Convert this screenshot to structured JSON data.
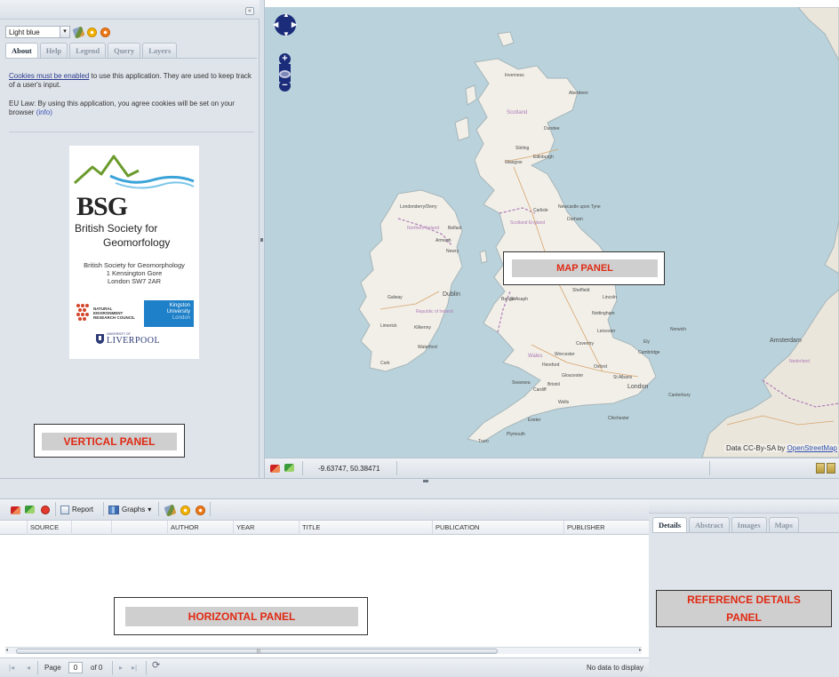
{
  "left_panel": {
    "style_select": "Light blue",
    "tabs": [
      {
        "label": "About",
        "active": true
      },
      {
        "label": "Help",
        "active": false
      },
      {
        "label": "Legend",
        "active": false
      },
      {
        "label": "Query",
        "active": false
      },
      {
        "label": "Layers",
        "active": false
      }
    ],
    "cookies_link": "Cookies must be enabled",
    "cookies_text": " to use this application. They are used to keep track of a user's input.",
    "eu_text": "EU Law: By using this application, you agree cookies will be set on your browser ",
    "info_link": "(info)",
    "logo": {
      "bsg": "BSG",
      "name_line1": "British Society for",
      "name_line2": "Geomorfology",
      "address": [
        "British Society for Geomorphology",
        "1 Kensington Gore",
        "London SW7 2AR"
      ],
      "nerc": [
        "NATURAL",
        "ENVIRONMENT",
        "RESEARCH COUNCIL"
      ],
      "kingston": [
        "Kingston",
        "University",
        "London"
      ],
      "liverpool_small": "UNIVERSITY OF",
      "liverpool": "LIVERPOOL"
    },
    "annotation": "VERTICAL PANEL"
  },
  "map": {
    "annotation": "MAP PANEL",
    "attribution_prefix": "Data CC-By-SA by ",
    "attribution_link": "OpenStreetMap",
    "places": [
      {
        "name": "Inverness"
      },
      {
        "name": "Aberdeen"
      },
      {
        "name": "Scotland"
      },
      {
        "name": "Dundee"
      },
      {
        "name": "Stirling"
      },
      {
        "name": "Glasgow"
      },
      {
        "name": "Edinburgh"
      },
      {
        "name": "Londonderry/Derry"
      },
      {
        "name": "Northern Ireland"
      },
      {
        "name": "Belfast"
      },
      {
        "name": "Armagh"
      },
      {
        "name": "Newry"
      },
      {
        "name": "Carlisle"
      },
      {
        "name": "Newcastle upon Tyne"
      },
      {
        "name": "Durham"
      },
      {
        "name": "Scotland England"
      },
      {
        "name": "Galway"
      },
      {
        "name": "Dublin"
      },
      {
        "name": "Republic of Ireland"
      },
      {
        "name": "Limerick"
      },
      {
        "name": "Kilkenny"
      },
      {
        "name": "Waterford"
      },
      {
        "name": "Cork"
      },
      {
        "name": "Bangor"
      },
      {
        "name": "St Asaph"
      },
      {
        "name": "Sheffield"
      },
      {
        "name": "Lincoln"
      },
      {
        "name": "Nottingham"
      },
      {
        "name": "Leicester"
      },
      {
        "name": "Coventry"
      },
      {
        "name": "Ely"
      },
      {
        "name": "Norwich"
      },
      {
        "name": "Cambridge"
      },
      {
        "name": "Wales"
      },
      {
        "name": "Worcester"
      },
      {
        "name": "Hereford"
      },
      {
        "name": "Oxford"
      },
      {
        "name": "St Albans"
      },
      {
        "name": "Gloucester"
      },
      {
        "name": "London"
      },
      {
        "name": "Swansea"
      },
      {
        "name": "Cardiff"
      },
      {
        "name": "Bristol"
      },
      {
        "name": "Wells"
      },
      {
        "name": "Canterbury"
      },
      {
        "name": "Chichester"
      },
      {
        "name": "Exeter"
      },
      {
        "name": "Plymouth"
      },
      {
        "name": "Truro"
      },
      {
        "name": "Amsterdam"
      },
      {
        "name": "Nederland"
      }
    ]
  },
  "map_status": {
    "coords": "-9.63747, 50.38471"
  },
  "bottom_panel": {
    "toolbar": {
      "report": "Report",
      "graphs": "Graphs"
    },
    "columns": [
      "SOURCE",
      "AUTHOR",
      "YEAR",
      "TITLE",
      "PUBLICATION",
      "PUBLISHER"
    ],
    "pager": {
      "page_label": "Page",
      "page_value": "0",
      "of_label": "of 0",
      "status": "No data to display"
    },
    "annotation": "HORIZONTAL PANEL"
  },
  "details_panel": {
    "tabs": [
      {
        "label": "Details",
        "active": true
      },
      {
        "label": "Abstract",
        "active": false
      },
      {
        "label": "Images",
        "active": false
      },
      {
        "label": "Maps",
        "active": false
      }
    ],
    "annotation_line1": "REFERENCE DETAILS",
    "annotation_line2": "PANEL"
  },
  "colors": {
    "sea": "#b9d2db",
    "land": "#f1efe8",
    "panel": "#dfe4ea",
    "annotation_text": "#e02a14",
    "nav_control": "#1b2c7a"
  },
  "icons": [
    "collapse-left-icon",
    "paint-icon",
    "yellow-circle-icon",
    "orange-circle-icon",
    "pan-icon",
    "zoom-in-icon",
    "zoom-out-icon",
    "world-icon",
    "measure-icon",
    "refresh-icon",
    "stop-icon",
    "report-icon",
    "graph-icon",
    "first-page-icon",
    "prev-page-icon",
    "next-page-icon",
    "last-page-icon"
  ]
}
